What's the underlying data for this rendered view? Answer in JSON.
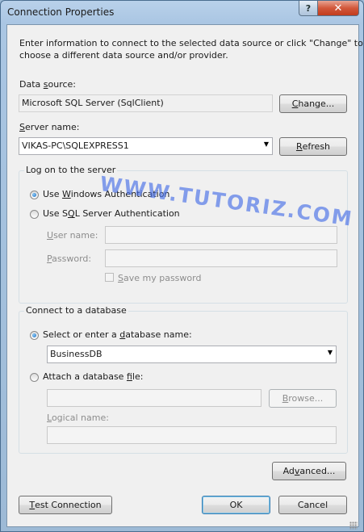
{
  "window": {
    "title": "Connection Properties"
  },
  "titlebar": {
    "help_glyph": "?",
    "close_glyph": "✕"
  },
  "intro": {
    "line1": "Enter information to connect to the selected data source or click \"Change\" to",
    "line2": "choose a different data source and/or provider."
  },
  "data_source": {
    "label_pre": "Data ",
    "label_key": "s",
    "label_post": "ource:",
    "value": "Microsoft SQL Server (SqlClient)",
    "change_button": {
      "key": "C",
      "rest": "hange..."
    }
  },
  "server": {
    "label_key": "S",
    "label_post": "erver name:",
    "value": "VIKAS-PC\\SQLEXPRESS1",
    "arrow": "▼",
    "refresh_button": {
      "key": "R",
      "rest": "efresh"
    }
  },
  "logon": {
    "title": "Log on to the server",
    "windows_auth": {
      "pre": "Use ",
      "key": "W",
      "post": "indows Authentication",
      "selected": true
    },
    "sql_auth": {
      "pre": "Use S",
      "key": "Q",
      "post": "L Server Authentication",
      "selected": false
    },
    "username": {
      "key": "U",
      "post": "ser name:",
      "value": ""
    },
    "password": {
      "key": "P",
      "post": "assword:",
      "value": ""
    },
    "save_password": {
      "key": "S",
      "post": "ave my password",
      "checked": false
    }
  },
  "database": {
    "title": "Connect to a database",
    "select_option": {
      "pre": "Select or enter a ",
      "key": "d",
      "post": "atabase name:",
      "selected": true
    },
    "db_name": {
      "value": "BusinessDB",
      "arrow": "▼"
    },
    "attach_option": {
      "pre": "Attach a database ",
      "key": "f",
      "post": "ile:",
      "selected": false
    },
    "attach_path": {
      "value": ""
    },
    "browse_button": {
      "key": "B",
      "rest": "rowse..."
    },
    "logical": {
      "key": "L",
      "post": "ogical name:",
      "value": ""
    }
  },
  "buttons": {
    "advanced": {
      "pre": "Ad",
      "key": "v",
      "post": "anced..."
    },
    "test": {
      "key": "T",
      "post": "est Connection"
    },
    "ok": {
      "label": "OK"
    },
    "cancel": {
      "label": "Cancel"
    }
  },
  "watermark": "WWW.TUTORIZ.COM"
}
